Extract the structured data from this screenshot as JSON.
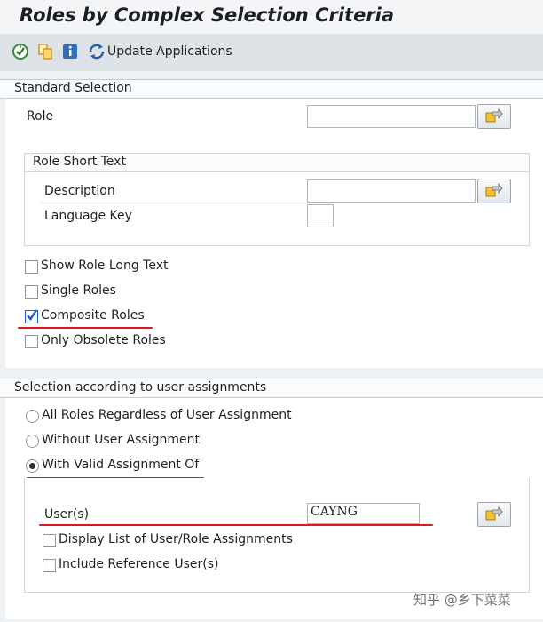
{
  "page": {
    "title": "Roles by Complex Selection Criteria"
  },
  "toolbar": {
    "update_label": "Update Applications",
    "icons": [
      "execute-icon",
      "copy-icon",
      "info-icon",
      "refresh-icon"
    ]
  },
  "standard_selection": {
    "heading": "Standard Selection",
    "role_label": "Role",
    "role_value": "",
    "short_text": {
      "heading": "Role Short Text",
      "description_label": "Description",
      "description_value": "",
      "language_label": "Language Key",
      "language_value": ""
    },
    "checkboxes": [
      {
        "label": "Show Role Long Text",
        "checked": false
      },
      {
        "label": "Single Roles",
        "checked": false
      },
      {
        "label": "Composite Roles",
        "checked": true
      },
      {
        "label": "Only Obsolete Roles",
        "checked": false
      }
    ]
  },
  "user_assignments": {
    "heading": "Selection according to user assignments",
    "radios": [
      {
        "label": "All Roles Regardless of User Assignment",
        "selected": false
      },
      {
        "label": "Without User Assignment",
        "selected": false
      },
      {
        "label": "With Valid Assignment Of",
        "selected": true
      }
    ],
    "users_label": "User(s)",
    "users_value": "CAYNG",
    "checkboxes": [
      {
        "label": "Display List of User/Role Assignments",
        "checked": false
      },
      {
        "label": "Include Reference User(s)",
        "checked": false
      }
    ]
  },
  "watermark": "知乎 @乡下菜菜",
  "colors": {
    "highlight_red": "#d71920",
    "check_blue": "#1a57c8",
    "toolbar_bg": "#dde2e6"
  }
}
